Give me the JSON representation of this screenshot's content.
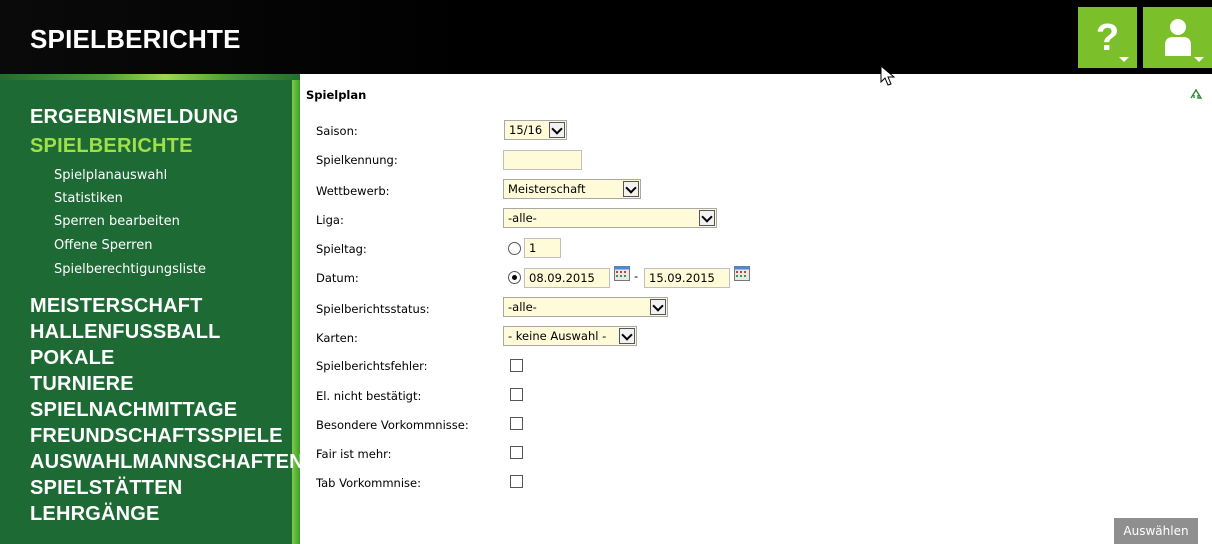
{
  "header": {
    "title": "SPIELBERICHTE",
    "help_label": "?",
    "accent_color": "#7bbf2a"
  },
  "sidebar": {
    "main_items": [
      {
        "label": "ERGEBNISMELDUNG",
        "active": false
      },
      {
        "label": "SPIELBERICHTE",
        "active": true
      },
      {
        "label": "MEISTERSCHAFT",
        "active": false
      },
      {
        "label": "HALLENFUSSBALL",
        "active": false
      },
      {
        "label": "POKALE",
        "active": false
      },
      {
        "label": "TURNIERE",
        "active": false
      },
      {
        "label": "SPIELNACHMITTAGE",
        "active": false
      },
      {
        "label": "FREUNDSCHAFTSSPIELE",
        "active": false
      },
      {
        "label": "AUSWAHLMANNSCHAFTEN",
        "active": false
      },
      {
        "label": "SPIELSTÄTTEN",
        "active": false
      },
      {
        "label": "LEHRGÄNGE",
        "active": false
      }
    ],
    "sub_items": [
      "Spielplanauswahl",
      "Statistiken",
      "Sperren bearbeiten",
      "Offene Sperren",
      "Spielberechtigungsliste"
    ],
    "background_color": "#1d6a35",
    "active_color": "#9ee04a"
  },
  "form": {
    "title": "Spielplan",
    "fields": {
      "saison": {
        "label": "Saison:",
        "value": "15/16"
      },
      "spielkennung": {
        "label": "Spielkennung:",
        "value": ""
      },
      "wettbewerb": {
        "label": "Wettbewerb:",
        "value": "Meisterschaft"
      },
      "liga": {
        "label": "Liga:",
        "value": "-alle-"
      },
      "spieltag": {
        "label": "Spieltag:",
        "value": "1",
        "selected": false
      },
      "datum": {
        "label": "Datum:",
        "from": "08.09.2015",
        "separator": "-",
        "to": "15.09.2015",
        "selected": true
      },
      "spielberichtsstatus": {
        "label": "Spielberichtsstatus:",
        "value": "-alle-"
      },
      "karten": {
        "label": "Karten:",
        "value": "- keine Auswahl -"
      },
      "spielberichtsfehler": {
        "label": "Spielberichtsfehler:",
        "checked": false
      },
      "el_nicht_bestaetigt": {
        "label": "El. nicht bestätigt:",
        "checked": false
      },
      "besondere_vorkommnisse": {
        "label": "Besondere Vorkommnisse:",
        "checked": false
      },
      "fair_ist_mehr": {
        "label": "Fair ist mehr:",
        "checked": false
      },
      "tab_vorkommnise": {
        "label": "Tab Vorkommnise:",
        "checked": false
      }
    },
    "submit_label": "Auswählen"
  }
}
